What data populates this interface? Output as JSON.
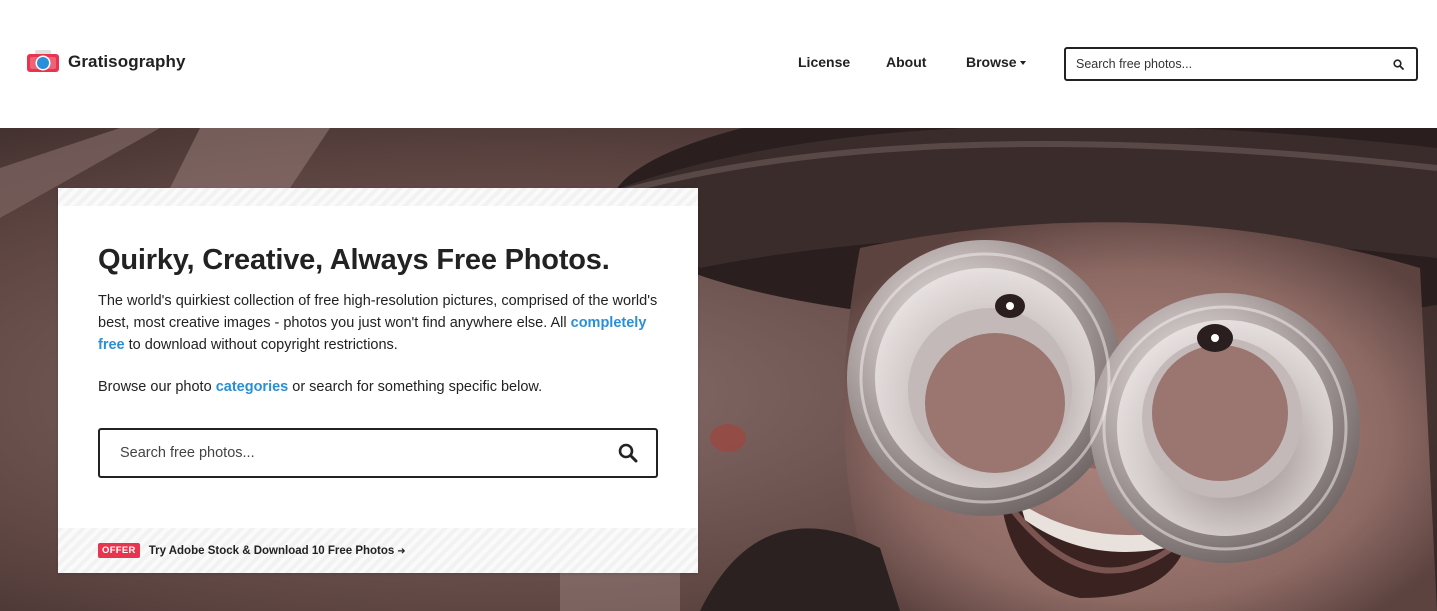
{
  "header": {
    "brand": "Gratisography",
    "nav": [
      {
        "label": "License"
      },
      {
        "label": "About"
      },
      {
        "label": "Browse"
      }
    ],
    "search_placeholder": "Search free photos..."
  },
  "hero": {
    "title": "Quirky, Creative, Always Free Photos.",
    "text_before_link": "The world's quirkiest collection of free high-resolution pictures, comprised of the world's best, most creative images - photos you just won't find anywhere else. All ",
    "link_free": "completely free",
    "text_after_link": " to download without copyright restrictions.",
    "browse_before": "Browse our photo ",
    "link_categories": "categories",
    "browse_after": " or search for something specific below.",
    "search_placeholder": "Search free photos...",
    "offer_badge": "OFFER",
    "offer_text": "Try Adobe Stock & Download 10 Free Photos"
  },
  "colors": {
    "accent_link": "#2a8fd8",
    "offer_badge": "#e8344e",
    "logo_red": "#e8344e",
    "logo_blue": "#2a8fd8"
  },
  "icons": [
    "camera-logo-icon",
    "caret-down-icon",
    "search-icon",
    "arrow-right-icon"
  ]
}
